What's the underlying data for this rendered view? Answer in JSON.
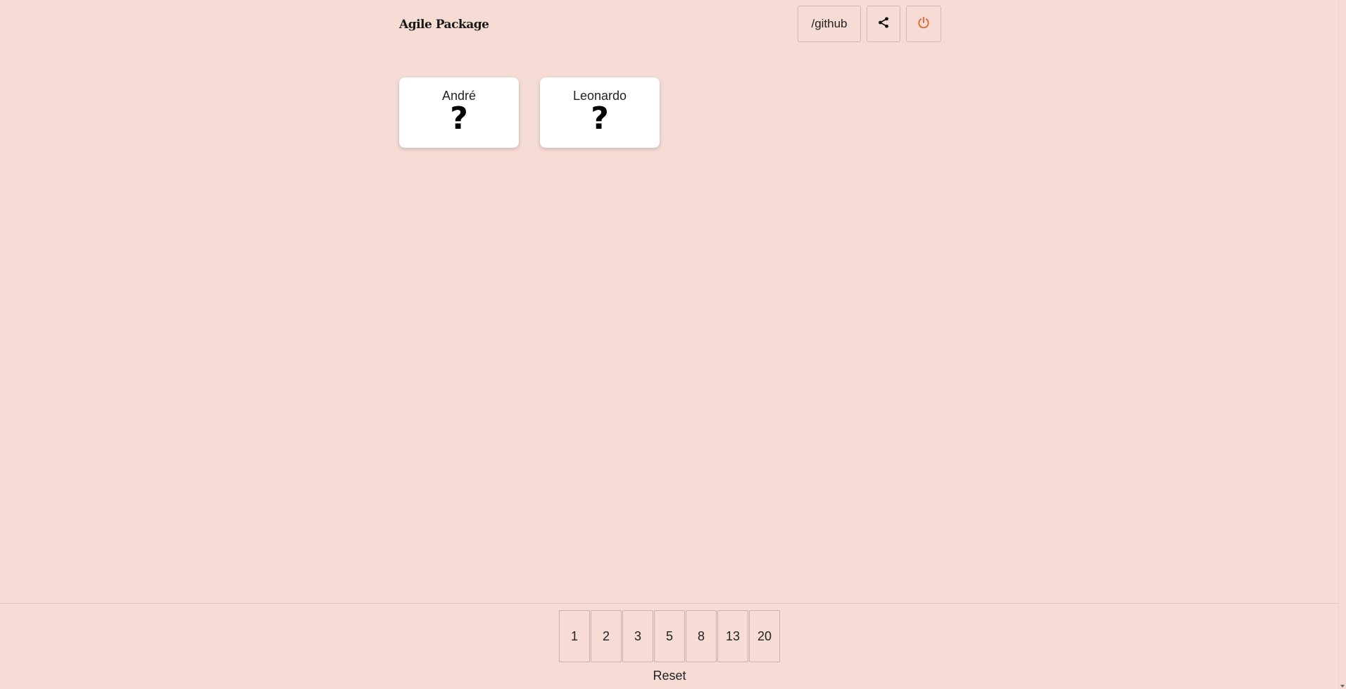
{
  "header": {
    "brand": "Agile Package",
    "github_label": "/github",
    "share_icon": "share-icon",
    "power_icon": "power-icon",
    "power_color": "#e4632a"
  },
  "players": [
    {
      "name": "André",
      "vote": "?"
    },
    {
      "name": "Leonardo",
      "vote": "?"
    }
  ],
  "deck": {
    "cards": [
      "1",
      "2",
      "3",
      "5",
      "8",
      "13",
      "20"
    ],
    "reset_label": "Reset"
  },
  "colors": {
    "background": "#f7dbd5",
    "card": "#ffffff"
  }
}
